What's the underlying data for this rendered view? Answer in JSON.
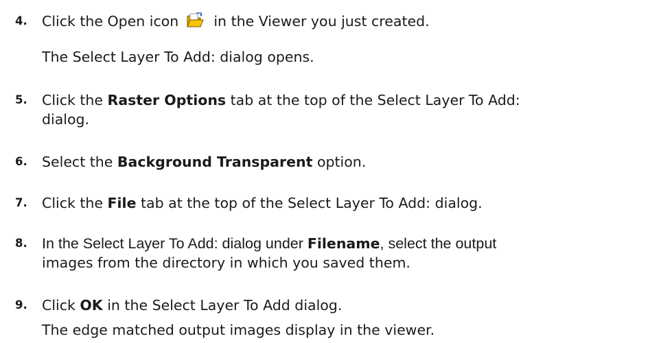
{
  "steps": [
    {
      "num": "4.",
      "pre": "Click the Open icon",
      "post": "in the Viewer you just created.",
      "result": "The Select Layer To Add: dialog opens."
    },
    {
      "num": "5.",
      "pre": "Click the ",
      "bold": "Raster Options",
      "post": " tab at the top of the Select Layer To Add:",
      "line2": "dialog."
    },
    {
      "num": "6.",
      "pre": "Select the ",
      "bold": "Background Transparent",
      "post": " option."
    },
    {
      "num": "7.",
      "pre": "Click the ",
      "bold": "File",
      "post": " tab at the top of the Select Layer To Add: dialog."
    },
    {
      "num": "8.",
      "pre": "In the Select Layer To Add: dialog under ",
      "bold": "Filename",
      "post": ", select the output",
      "line2": "images from the directory in which you saved them."
    },
    {
      "num": "9.",
      "pre": "Click ",
      "bold": "OK",
      "post": " in the Select Layer To Add dialog.",
      "result": "The edge matched output images display in the viewer."
    }
  ],
  "icons": {
    "open": "open-folder-icon"
  }
}
